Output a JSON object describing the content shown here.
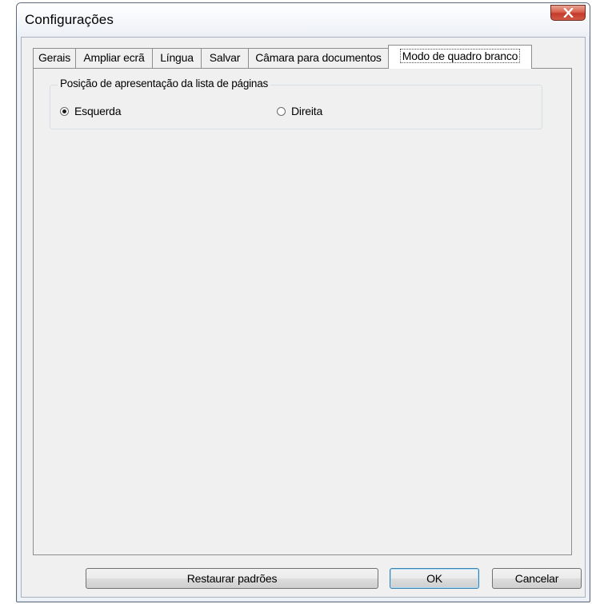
{
  "window": {
    "title": "Configurações"
  },
  "tabs": [
    {
      "label": "Gerais"
    },
    {
      "label": "Ampliar ecrã"
    },
    {
      "label": "Língua"
    },
    {
      "label": "Salvar"
    },
    {
      "label": "Câmara para documentos"
    },
    {
      "label": "Modo de quadro branco",
      "active": true
    }
  ],
  "group": {
    "title": "Posição de apresentação da lista de páginas",
    "options": [
      {
        "label": "Esquerda",
        "checked": true
      },
      {
        "label": "Direita",
        "checked": false
      }
    ]
  },
  "buttons": {
    "restore": "Restaurar padrões",
    "ok": "OK",
    "cancel": "Cancelar"
  },
  "icons": {
    "close": "close-icon"
  }
}
